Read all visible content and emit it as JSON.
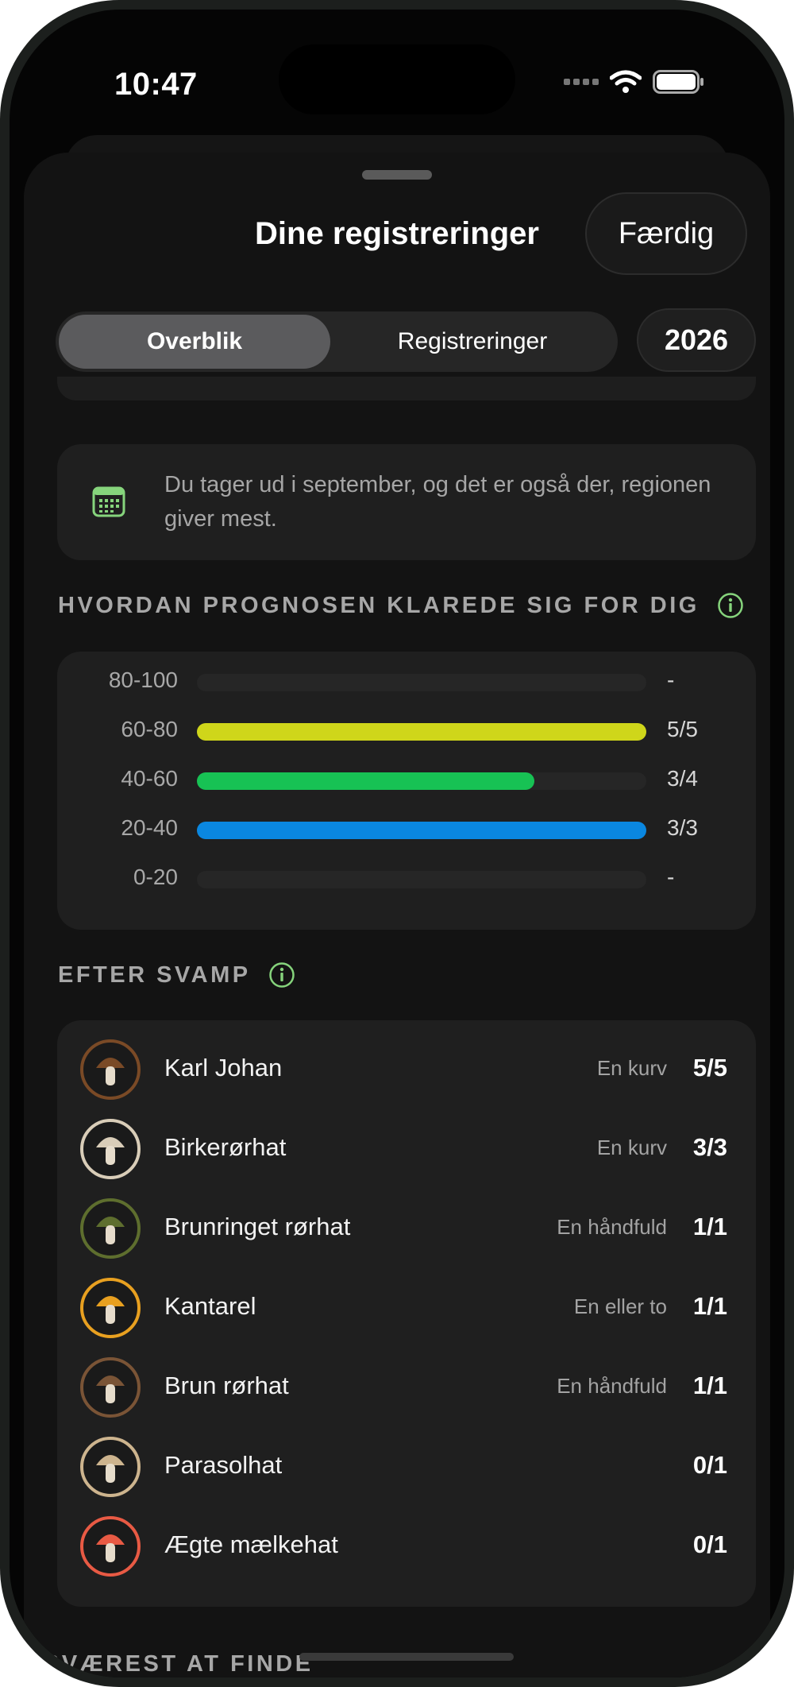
{
  "status": {
    "time": "10:47"
  },
  "header": {
    "title": "Dine registreringer",
    "done_label": "Færdig"
  },
  "segmented": {
    "items": [
      "Overblik",
      "Registreringer"
    ],
    "selected": "Overblik"
  },
  "year": "2026",
  "tip": {
    "text": "Du tager ud i september, og det er også der, regionen giver mest.",
    "icon": "calendar-icon"
  },
  "forecast": {
    "heading": "HVORDAN PROGNOSEN KLAREDE SIG FOR DIG",
    "rows": [
      {
        "label": "80-100",
        "value": "-",
        "ratio": 0,
        "color": "#d3d81c"
      },
      {
        "label": "60-80",
        "value": "5/5",
        "ratio": 1.0,
        "color": "#cfd61a"
      },
      {
        "label": "40-60",
        "value": "3/4",
        "ratio": 0.75,
        "color": "#17c254"
      },
      {
        "label": "20-40",
        "value": "3/3",
        "ratio": 1.0,
        "color": "#0a87e0"
      },
      {
        "label": "0-20",
        "value": "-",
        "ratio": 0,
        "color": "#888888"
      }
    ]
  },
  "by_species": {
    "heading": "EFTER SVAMP",
    "items": [
      {
        "name": "Karl Johan",
        "amount": "En kurv",
        "score": "5/5",
        "ring": "#7a4a26"
      },
      {
        "name": "Birkerørhat",
        "amount": "En kurv",
        "score": "3/3",
        "ring": "#d9cdb8"
      },
      {
        "name": "Brunringet rørhat",
        "amount": "En håndfuld",
        "score": "1/1",
        "ring": "#5e6e2e"
      },
      {
        "name": "Kantarel",
        "amount": "En eller to",
        "score": "1/1",
        "ring": "#e8a020"
      },
      {
        "name": "Brun rørhat",
        "amount": "En håndfuld",
        "score": "1/1",
        "ring": "#7a5436"
      },
      {
        "name": "Parasolhat",
        "amount": "",
        "score": "0/1",
        "ring": "#cdb48e"
      },
      {
        "name": "Ægte mælkehat",
        "amount": "",
        "score": "0/1",
        "ring": "#e85a44"
      }
    ]
  },
  "next_section": {
    "heading": "SVÆREST AT FINDE"
  }
}
